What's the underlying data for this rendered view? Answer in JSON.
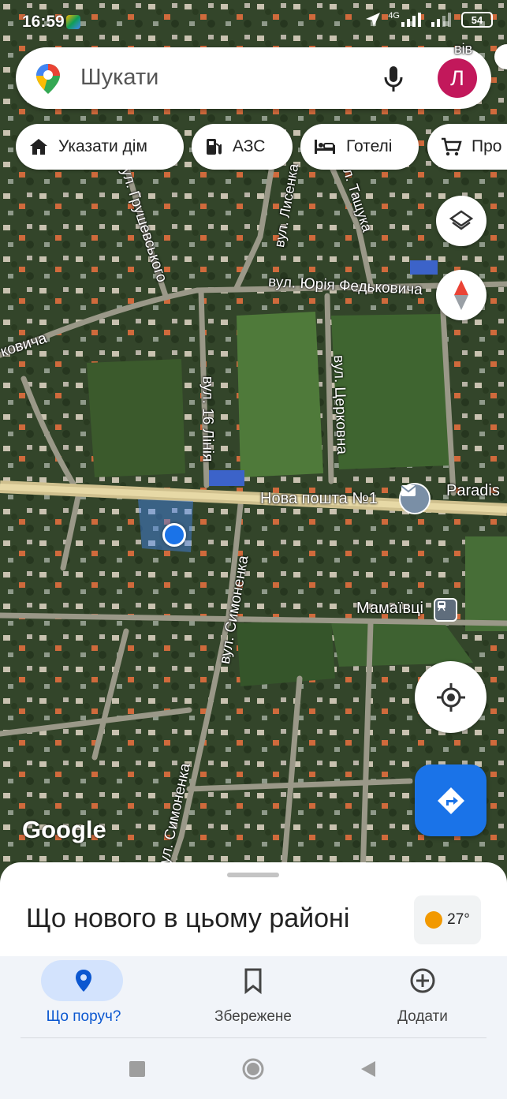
{
  "status_bar": {
    "time": "16:59",
    "network": "4G",
    "battery": "54"
  },
  "search": {
    "placeholder": "Шукати",
    "avatar_letter": "Л"
  },
  "chips": [
    {
      "label": "Указати дім",
      "icon": "home-icon"
    },
    {
      "label": "АЗС",
      "icon": "gas-station-icon"
    },
    {
      "label": "Готелі",
      "icon": "hotel-icon"
    },
    {
      "label": "Про",
      "icon": "cart-icon"
    }
  ],
  "map": {
    "labels": {
      "street_grushevskogo": "вул. Грушевського",
      "street_lysenka": "вул. Лисенка",
      "street_tashchuka": "вул. Тащука",
      "street_fedkovycha": "вул. Юрія Федьковича",
      "street_kovycha": "ковича",
      "street_16_liniya": "вул. 16 Лінія",
      "street_tserkovna": "вул. Церковна",
      "street_symonenka_1": "вул. Симоненка",
      "street_symonenka_2": "вул. Симоненка",
      "nova_poshta": "Нова пошта №1",
      "paradise": "Paradis",
      "mamaivtsi": "Мамаївці",
      "top_partial": "вів"
    },
    "attribution": "Google",
    "colors": {
      "location_dot": "#1a73e8",
      "directions_button": "#1a73e8",
      "compass_red": "#ea4335"
    }
  },
  "sheet": {
    "title": "Що нового в цьому районі",
    "temperature": "27°"
  },
  "bottom_nav": [
    {
      "label": "Що поруч?",
      "icon": "explore-pin-icon",
      "active": true
    },
    {
      "label": "Збережене",
      "icon": "bookmark-icon",
      "active": false
    },
    {
      "label": "Додати",
      "icon": "add-circle-icon",
      "active": false
    }
  ]
}
